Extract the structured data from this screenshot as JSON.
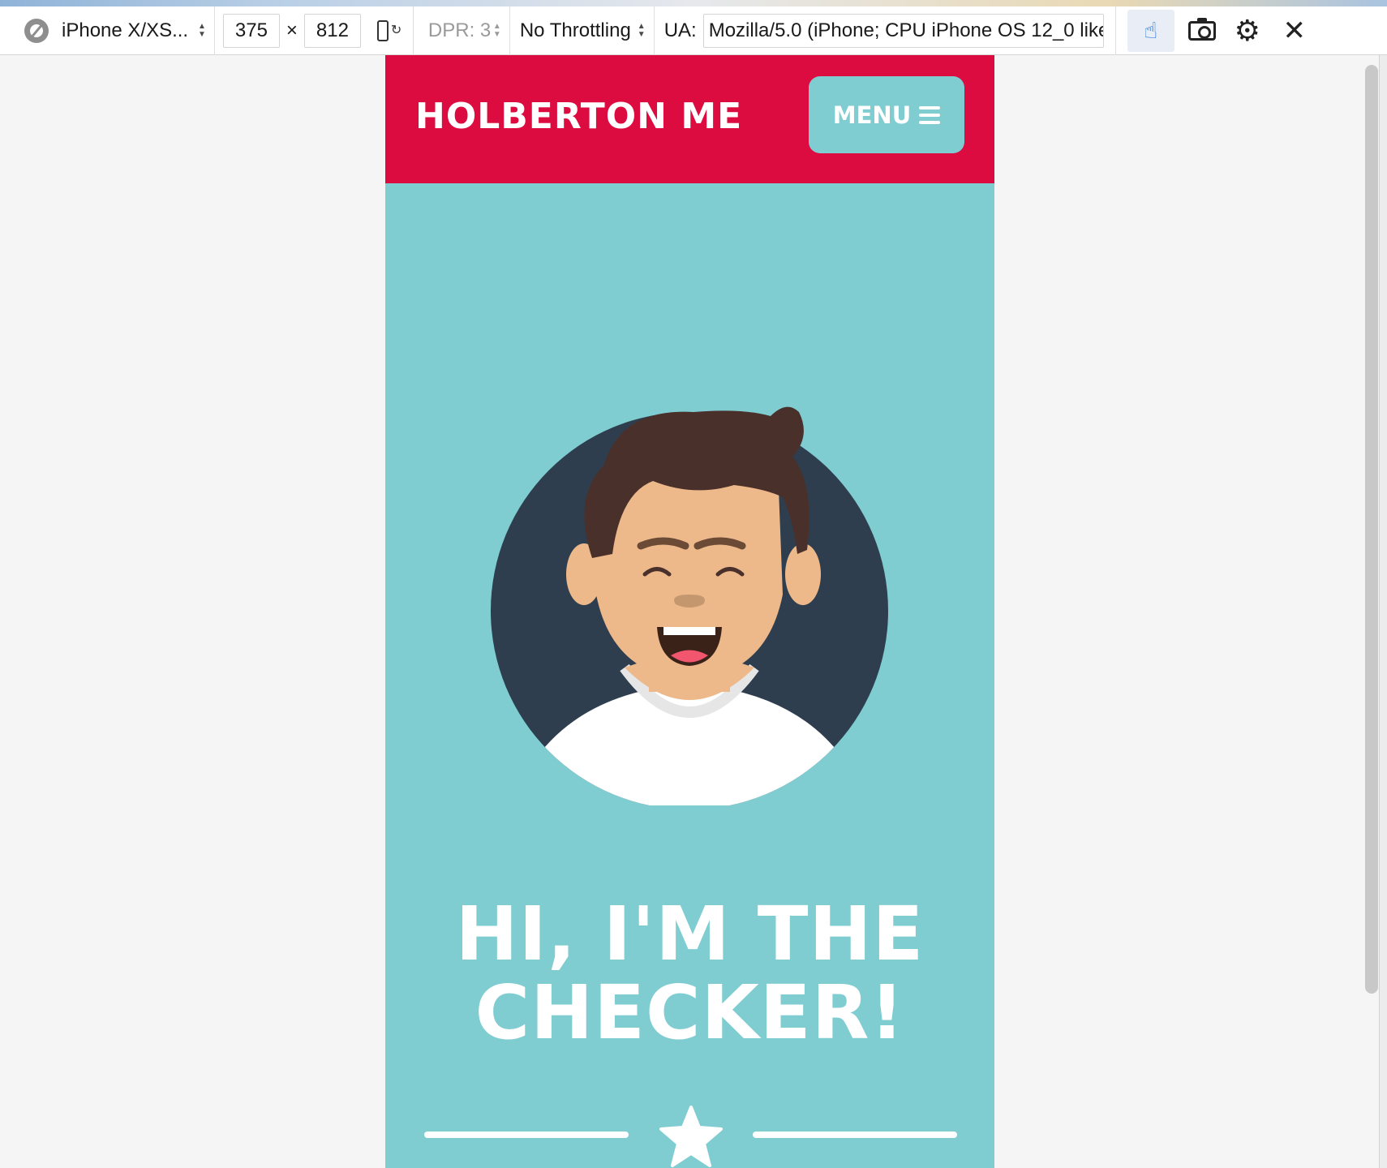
{
  "devtools": {
    "device": "iPhone X/XS...",
    "width": "375",
    "times": "×",
    "height": "812",
    "dpr": "DPR: 3",
    "throttling": "No Throttling",
    "ua_label": "UA:",
    "ua_value": "Mozilla/5.0 (iPhone; CPU iPhone OS 12_0 like M",
    "icons": [
      "compass-icon",
      "rotate-icon",
      "touch-icon",
      "camera-icon",
      "gear-icon",
      "close-icon"
    ]
  },
  "page": {
    "brand": "HOLBERTON ME",
    "menu_label": "MENU",
    "hero_line1": "HI, I'M THE",
    "hero_line2": "CHECKER!",
    "colors": {
      "header": "#dc0b40",
      "background": "#7fcdd1",
      "avatar_circle": "#2e3e4f",
      "hair": "#4a302a",
      "skin": "#edb98a",
      "shirt": "#ffffff"
    }
  }
}
